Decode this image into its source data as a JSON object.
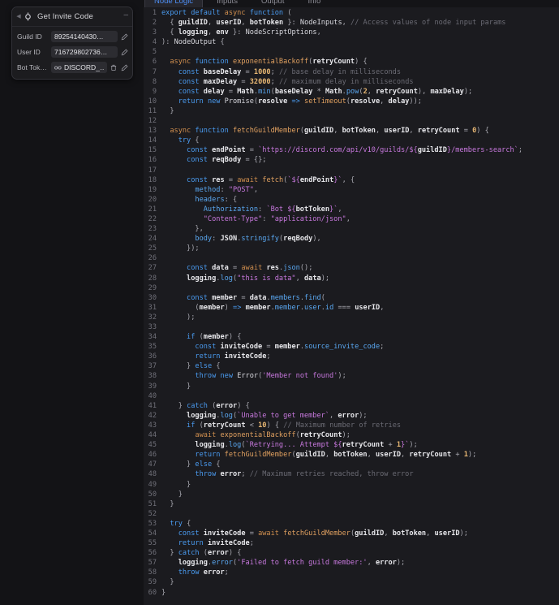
{
  "node": {
    "title": "Get Invite Code",
    "collapse_icon": "chevron-left-icon",
    "node_icon": "node-port-icon",
    "minimize_label": "–",
    "params": [
      {
        "label": "Guild ID",
        "value": "89254140430…",
        "secret": false,
        "has_delete": false,
        "edit_icon": "pencil-icon"
      },
      {
        "label": "User ID",
        "value": "716729802736…",
        "secret": false,
        "has_delete": false,
        "edit_icon": "pencil-icon"
      },
      {
        "label": "Bot Tok…",
        "value": "DISCORD_…",
        "secret": true,
        "has_delete": true,
        "edit_icon": "pencil-icon",
        "secret_icon": "key-icon",
        "delete_icon": "trash-icon"
      }
    ]
  },
  "tabs": [
    {
      "label": "Node Logic",
      "active": true
    },
    {
      "label": "Inputs",
      "active": false
    },
    {
      "label": "Output",
      "active": false
    },
    {
      "label": "Info",
      "active": false
    }
  ],
  "colors": {
    "accent": "#4e8ff5",
    "editor_bg": "#1b1b1f",
    "canvas_bg": "#131316",
    "node_bg": "#1c1c1f",
    "keyword": "#4a9bf0",
    "string": "#c778dd",
    "number": "#e6b673",
    "comment": "#6b6b74",
    "function": "#e0a060",
    "property": "#5aa8f2"
  },
  "code": {
    "language": "typescript",
    "first_line": 1,
    "last_line": 60,
    "lines": [
      {
        "n": 1,
        "html": "<span class=\"kw\">export</span> <span class=\"kw\">default</span> <span class=\"kw2\">async</span> <span class=\"kw\">function</span> <span class=\"pun\">(</span>"
      },
      {
        "n": 2,
        "html": "  <span class=\"pun\">{</span> <span class=\"id\">guildID</span><span class=\"pun\">,</span> <span class=\"id\">userID</span><span class=\"pun\">,</span> <span class=\"id\">botToken</span> <span class=\"pun\">}</span><span class=\"pun\">:</span> <span class=\"type\">NodeInputs</span><span class=\"pun\">,</span> <span class=\"cmt\">// Access values of node input params</span>"
      },
      {
        "n": 3,
        "html": "  <span class=\"pun\">{</span> <span class=\"id\">logging</span><span class=\"pun\">,</span> <span class=\"id\">env</span> <span class=\"pun\">}</span><span class=\"pun\">:</span> <span class=\"type\">NodeScriptOptions</span><span class=\"pun\">,</span>"
      },
      {
        "n": 4,
        "html": "<span class=\"pun\">)</span><span class=\"pun\">:</span> <span class=\"type\">NodeOutput</span> <span class=\"pun\">{</span>"
      },
      {
        "n": 5,
        "html": ""
      },
      {
        "n": 6,
        "html": "  <span class=\"kw2\">async</span> <span class=\"kw\">function</span> <span class=\"fn\">exponentialBackoff</span><span class=\"pun\">(</span><span class=\"id\">retryCount</span><span class=\"pun\">)</span> <span class=\"pun\">{</span>"
      },
      {
        "n": 7,
        "html": "    <span class=\"kw\">const</span> <span class=\"id\">baseDelay</span> <span class=\"pun\">=</span> <span class=\"num\">1000</span><span class=\"pun\">;</span> <span class=\"cmt\">// base delay in milliseconds</span>"
      },
      {
        "n": 8,
        "html": "    <span class=\"kw\">const</span> <span class=\"id\">maxDelay</span> <span class=\"pun\">=</span> <span class=\"num\">32000</span><span class=\"pun\">;</span> <span class=\"cmt\">// maximum delay in milliseconds</span>"
      },
      {
        "n": 9,
        "html": "    <span class=\"kw\">const</span> <span class=\"id\">delay</span> <span class=\"pun\">=</span> <span class=\"id\">Math</span><span class=\"pun\">.</span><span class=\"prop\">min</span><span class=\"pun\">(</span><span class=\"id\">baseDelay</span> <span class=\"pun\">*</span> <span class=\"id\">Math</span><span class=\"pun\">.</span><span class=\"prop\">pow</span><span class=\"pun\">(</span><span class=\"num\">2</span><span class=\"pun\">,</span> <span class=\"id\">retryCount</span><span class=\"pun\">)</span><span class=\"pun\">,</span> <span class=\"id\">maxDelay</span><span class=\"pun\">)</span><span class=\"pun\">;</span>"
      },
      {
        "n": 10,
        "html": "    <span class=\"kw\">return</span> <span class=\"kw\">new</span> <span class=\"type\">Promise</span><span class=\"pun\">(</span><span class=\"id\">resolve</span> <span class=\"kw\">=&gt;</span> <span class=\"fn\">setTimeout</span><span class=\"pun\">(</span><span class=\"id\">resolve</span><span class=\"pun\">,</span> <span class=\"id\">delay</span><span class=\"pun\">))</span><span class=\"pun\">;</span>"
      },
      {
        "n": 11,
        "html": "  <span class=\"pun\">}</span>"
      },
      {
        "n": 12,
        "html": ""
      },
      {
        "n": 13,
        "html": "  <span class=\"kw2\">async</span> <span class=\"kw\">function</span> <span class=\"fn\">fetchGuildMember</span><span class=\"pun\">(</span><span class=\"id\">guildID</span><span class=\"pun\">,</span> <span class=\"id\">botToken</span><span class=\"pun\">,</span> <span class=\"id\">userID</span><span class=\"pun\">,</span> <span class=\"id\">retryCount</span> <span class=\"pun\">=</span> <span class=\"num\">0</span><span class=\"pun\">)</span> <span class=\"pun\">{</span>"
      },
      {
        "n": 14,
        "html": "    <span class=\"kw\">try</span> <span class=\"pun\">{</span>"
      },
      {
        "n": 15,
        "html": "      <span class=\"kw\">const</span> <span class=\"id\">endPoint</span> <span class=\"pun\">=</span> <span class=\"str\">`https://discord.com/api/v10/guilds/${</span><span class=\"id\">guildID</span><span class=\"str\">}/members-search`</span><span class=\"pun\">;</span>"
      },
      {
        "n": 16,
        "html": "      <span class=\"kw\">const</span> <span class=\"id\">reqBody</span> <span class=\"pun\">=</span> <span class=\"pun\">{};</span>"
      },
      {
        "n": 17,
        "html": ""
      },
      {
        "n": 18,
        "html": "      <span class=\"kw\">const</span> <span class=\"id\">res</span> <span class=\"pun\">=</span> <span class=\"kw2\">await</span> <span class=\"fn\">fetch</span><span class=\"pun\">(</span><span class=\"str\">`${</span><span class=\"id\">endPoint</span><span class=\"str\">}`</span><span class=\"pun\">,</span> <span class=\"pun\">{</span>"
      },
      {
        "n": 19,
        "html": "        <span class=\"prop\">method</span><span class=\"pun\">:</span> <span class=\"str\">\"POST\"</span><span class=\"pun\">,</span>"
      },
      {
        "n": 20,
        "html": "        <span class=\"prop\">headers</span><span class=\"pun\">:</span> <span class=\"pun\">{</span>"
      },
      {
        "n": 21,
        "html": "          <span class=\"prop\">Authorization</span><span class=\"pun\">:</span> <span class=\"str\">`Bot ${</span><span class=\"id\">botToken</span><span class=\"str\">}`</span><span class=\"pun\">,</span>"
      },
      {
        "n": 22,
        "html": "          <span class=\"str\">\"Content-Type\"</span><span class=\"pun\">:</span> <span class=\"str\">\"application/json\"</span><span class=\"pun\">,</span>"
      },
      {
        "n": 23,
        "html": "        <span class=\"pun\">},</span>"
      },
      {
        "n": 24,
        "html": "        <span class=\"prop\">body</span><span class=\"pun\">:</span> <span class=\"id\">JSON</span><span class=\"pun\">.</span><span class=\"prop\">stringify</span><span class=\"pun\">(</span><span class=\"id\">reqBody</span><span class=\"pun\">),</span>"
      },
      {
        "n": 25,
        "html": "      <span class=\"pun\">});</span>"
      },
      {
        "n": 26,
        "html": ""
      },
      {
        "n": 27,
        "html": "      <span class=\"kw\">const</span> <span class=\"id\">data</span> <span class=\"pun\">=</span> <span class=\"kw2\">await</span> <span class=\"id\">res</span><span class=\"pun\">.</span><span class=\"prop\">json</span><span class=\"pun\">();</span>"
      },
      {
        "n": 28,
        "html": "      <span class=\"id\">logging</span><span class=\"pun\">.</span><span class=\"prop\">log</span><span class=\"pun\">(</span><span class=\"str\">\"this is data\"</span><span class=\"pun\">,</span> <span class=\"id\">data</span><span class=\"pun\">);</span>"
      },
      {
        "n": 29,
        "html": ""
      },
      {
        "n": 30,
        "html": "      <span class=\"kw\">const</span> <span class=\"id\">member</span> <span class=\"pun\">=</span> <span class=\"id\">data</span><span class=\"pun\">.</span><span class=\"prop\">members</span><span class=\"pun\">.</span><span class=\"prop\">find</span><span class=\"pun\">(</span>"
      },
      {
        "n": 31,
        "html": "        <span class=\"pun\">(</span><span class=\"id\">member</span><span class=\"pun\">)</span> <span class=\"kw\">=&gt;</span> <span class=\"id\">member</span><span class=\"pun\">.</span><span class=\"prop\">member</span><span class=\"pun\">.</span><span class=\"prop\">user</span><span class=\"pun\">.</span><span class=\"prop\">id</span> <span class=\"pun\">===</span> <span class=\"id\">userID</span><span class=\"pun\">,</span>"
      },
      {
        "n": 32,
        "html": "      <span class=\"pun\">);</span>"
      },
      {
        "n": 33,
        "html": ""
      },
      {
        "n": 34,
        "html": "      <span class=\"kw\">if</span> <span class=\"pun\">(</span><span class=\"id\">member</span><span class=\"pun\">)</span> <span class=\"pun\">{</span>"
      },
      {
        "n": 35,
        "html": "        <span class=\"kw\">const</span> <span class=\"id\">inviteCode</span> <span class=\"pun\">=</span> <span class=\"id\">member</span><span class=\"pun\">.</span><span class=\"prop\">source_invite_code</span><span class=\"pun\">;</span>"
      },
      {
        "n": 36,
        "html": "        <span class=\"kw\">return</span> <span class=\"id\">inviteCode</span><span class=\"pun\">;</span>"
      },
      {
        "n": 37,
        "html": "      <span class=\"pun\">}</span> <span class=\"kw\">else</span> <span class=\"pun\">{</span>"
      },
      {
        "n": 38,
        "html": "        <span class=\"kw\">throw</span> <span class=\"kw\">new</span> <span class=\"type\">Error</span><span class=\"pun\">(</span><span class=\"str\">'Member not found'</span><span class=\"pun\">);</span>"
      },
      {
        "n": 39,
        "html": "      <span class=\"pun\">}</span>"
      },
      {
        "n": 40,
        "html": ""
      },
      {
        "n": 41,
        "html": "    <span class=\"pun\">}</span> <span class=\"kw\">catch</span> <span class=\"pun\">(</span><span class=\"id\">error</span><span class=\"pun\">)</span> <span class=\"pun\">{</span>"
      },
      {
        "n": 42,
        "html": "      <span class=\"id\">logging</span><span class=\"pun\">.</span><span class=\"prop\">log</span><span class=\"pun\">(</span><span class=\"str\">`Unable to get member`</span><span class=\"pun\">,</span> <span class=\"id\">error</span><span class=\"pun\">);</span>"
      },
      {
        "n": 43,
        "html": "      <span class=\"kw\">if</span> <span class=\"pun\">(</span><span class=\"id\">retryCount</span> <span class=\"pun\">&lt;</span> <span class=\"num\">10</span><span class=\"pun\">)</span> <span class=\"pun\">{</span> <span class=\"cmt\">// Maximum number of retries</span>"
      },
      {
        "n": 44,
        "html": "        <span class=\"kw2\">await</span> <span class=\"fn\">exponentialBackoff</span><span class=\"pun\">(</span><span class=\"id\">retryCount</span><span class=\"pun\">);</span>"
      },
      {
        "n": 45,
        "html": "        <span class=\"id\">logging</span><span class=\"pun\">.</span><span class=\"prop\">log</span><span class=\"pun\">(</span><span class=\"str\">`Retrying... Attempt ${</span><span class=\"id\">retryCount</span> <span class=\"pun\">+</span> <span class=\"num\">1</span><span class=\"str\">}`</span><span class=\"pun\">);</span>"
      },
      {
        "n": 46,
        "html": "        <span class=\"kw\">return</span> <span class=\"fn\">fetchGuildMember</span><span class=\"pun\">(</span><span class=\"id\">guildID</span><span class=\"pun\">,</span> <span class=\"id\">botToken</span><span class=\"pun\">,</span> <span class=\"id\">userID</span><span class=\"pun\">,</span> <span class=\"id\">retryCount</span> <span class=\"pun\">+</span> <span class=\"num\">1</span><span class=\"pun\">);</span>"
      },
      {
        "n": 47,
        "html": "      <span class=\"pun\">}</span> <span class=\"kw\">else</span> <span class=\"pun\">{</span>"
      },
      {
        "n": 48,
        "html": "        <span class=\"kw\">throw</span> <span class=\"id\">error</span><span class=\"pun\">;</span> <span class=\"cmt\">// Maximum retries reached, throw error</span>"
      },
      {
        "n": 49,
        "html": "      <span class=\"pun\">}</span>"
      },
      {
        "n": 50,
        "html": "    <span class=\"pun\">}</span>"
      },
      {
        "n": 51,
        "html": "  <span class=\"pun\">}</span>"
      },
      {
        "n": 52,
        "html": ""
      },
      {
        "n": 53,
        "html": "  <span class=\"kw\">try</span> <span class=\"pun\">{</span>"
      },
      {
        "n": 54,
        "html": "    <span class=\"kw\">const</span> <span class=\"id\">inviteCode</span> <span class=\"pun\">=</span> <span class=\"kw2\">await</span> <span class=\"fn\">fetchGuildMember</span><span class=\"pun\">(</span><span class=\"id\">guildID</span><span class=\"pun\">,</span> <span class=\"id\">botToken</span><span class=\"pun\">,</span> <span class=\"id\">userID</span><span class=\"pun\">);</span>"
      },
      {
        "n": 55,
        "html": "    <span class=\"kw\">return</span> <span class=\"id\">inviteCode</span><span class=\"pun\">;</span>"
      },
      {
        "n": 56,
        "html": "  <span class=\"pun\">}</span> <span class=\"kw\">catch</span> <span class=\"pun\">(</span><span class=\"id\">error</span><span class=\"pun\">)</span> <span class=\"pun\">{</span>"
      },
      {
        "n": 57,
        "html": "    <span class=\"id\">logging</span><span class=\"pun\">.</span><span class=\"prop\">error</span><span class=\"pun\">(</span><span class=\"str\">'Failed to fetch guild member:'</span><span class=\"pun\">,</span> <span class=\"id\">error</span><span class=\"pun\">);</span>"
      },
      {
        "n": 58,
        "html": "    <span class=\"kw\">throw</span> <span class=\"id\">error</span><span class=\"pun\">;</span>"
      },
      {
        "n": 59,
        "html": "  <span class=\"pun\">}</span>"
      },
      {
        "n": 60,
        "html": "<span class=\"pun\">}</span>"
      }
    ]
  }
}
